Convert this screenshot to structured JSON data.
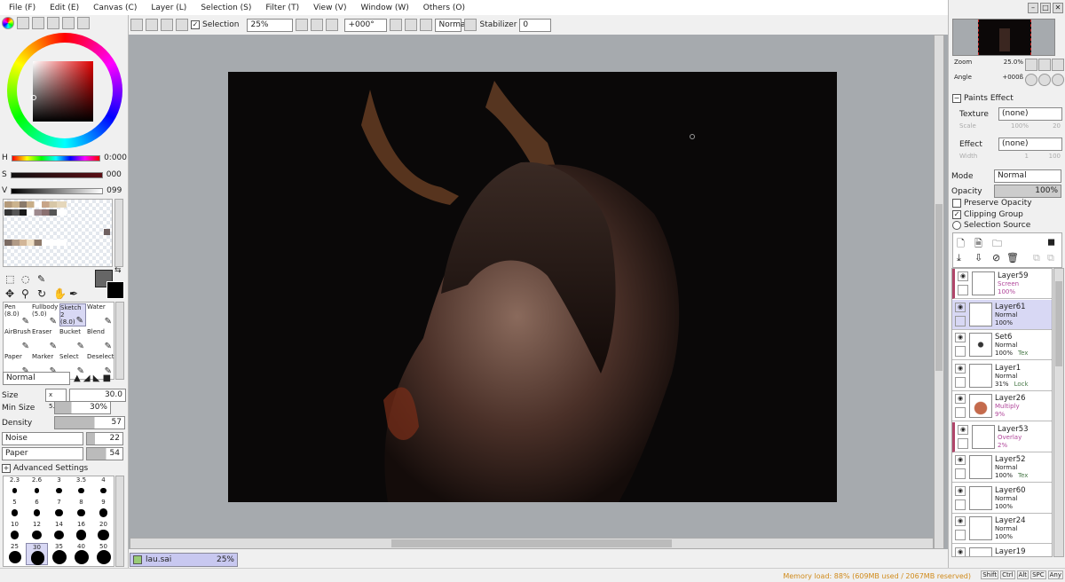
{
  "menu": [
    "File (F)",
    "Edit (E)",
    "Canvas (C)",
    "Layer (L)",
    "Selection (S)",
    "Filter (T)",
    "View (V)",
    "Window (W)",
    "Others (O)"
  ],
  "toolbar": {
    "selection_label": "Selection",
    "zoom": "25%",
    "angle": "+000°",
    "blend": "Normal",
    "stabilizer_label": "Stabilizer",
    "stabilizer_value": "0"
  },
  "color": {
    "h_label": "H",
    "h_value": "0:000",
    "s_label": "S",
    "s_value": "000",
    "v_label": "V",
    "v_value": "099",
    "accent": "#5a0e14"
  },
  "tools": {
    "brushes": [
      {
        "name": "Pen",
        "size": "(8.0)"
      },
      {
        "name": "Fullbody",
        "size": "(5.0)"
      },
      {
        "name": "Sketch 2",
        "size": "(8.0)"
      },
      {
        "name": "Water",
        "size": ""
      },
      {
        "name": "AirBrush",
        "size": ""
      },
      {
        "name": "Eraser",
        "size": ""
      },
      {
        "name": "Bucket",
        "size": ""
      },
      {
        "name": "Blend",
        "size": ""
      },
      {
        "name": "Paper",
        "size": ""
      },
      {
        "name": "Marker",
        "size": ""
      },
      {
        "name": "Select",
        "size": ""
      },
      {
        "name": "Deselect",
        "size": ""
      }
    ]
  },
  "brush": {
    "mode": "Normal",
    "size_label": "Size",
    "size_mult": "x 5.0",
    "size_value": "30.0",
    "minsize_label": "Min Size",
    "minsize_value": "30%",
    "density_label": "Density",
    "density_value": "57",
    "noise_label": "Noise",
    "noise_value": "22",
    "paper_label": "Paper",
    "paper_value": "54",
    "advanced_label": "Advanced Settings",
    "sizes": [
      "2.3",
      "2.6",
      "3",
      "3.5",
      "4",
      "5",
      "6",
      "7",
      "8",
      "9",
      "10",
      "12",
      "14",
      "16",
      "20",
      "25",
      "30",
      "35",
      "40",
      "50"
    ]
  },
  "document": {
    "name": "lau.sai",
    "zoom": "25%"
  },
  "navigator": {
    "zoom_label": "Zoom",
    "zoom_value": "25.0%",
    "angle_label": "Angle",
    "angle_value": "+000ß"
  },
  "paints": {
    "title": "Paints Effect",
    "texture_label": "Texture",
    "texture_value": "(none)",
    "scale_label": "Scale",
    "scale_value": "100%",
    "scale_num": "20",
    "effect_label": "Effect",
    "effect_value": "(none)",
    "width_label": "Width",
    "width_value": "1",
    "width_num": "100"
  },
  "layer_props": {
    "mode_label": "Mode",
    "mode_value": "Normal",
    "opacity_label": "Opacity",
    "opacity_value": "100%",
    "preserve": "Preserve Opacity",
    "clipping": "Clipping Group",
    "selsource": "Selection Source"
  },
  "layers": [
    {
      "name": "Layer59",
      "mode": "Screen",
      "opacity": "100%",
      "extra": ""
    },
    {
      "name": "Layer61",
      "mode": "Normal",
      "opacity": "100%",
      "extra": ""
    },
    {
      "name": "Set6",
      "mode": "Normal",
      "opacity": "100%",
      "extra": "Tex"
    },
    {
      "name": "Layer1",
      "mode": "Normal",
      "opacity": "31%",
      "extra": "Lock"
    },
    {
      "name": "Layer26",
      "mode": "Multiply",
      "opacity": "9%",
      "extra": ""
    },
    {
      "name": "Layer53",
      "mode": "Overlay",
      "opacity": "2%",
      "extra": ""
    },
    {
      "name": "Layer52",
      "mode": "Normal",
      "opacity": "100%",
      "extra": "Tex"
    },
    {
      "name": "Layer60",
      "mode": "Normal",
      "opacity": "100%",
      "extra": ""
    },
    {
      "name": "Layer24",
      "mode": "Normal",
      "opacity": "100%",
      "extra": ""
    },
    {
      "name": "Layer19",
      "mode": "",
      "opacity": "",
      "extra": ""
    }
  ],
  "status": {
    "memory": "Memory load: 88% (609MB used / 2067MB reserved)",
    "keys": [
      "Shift",
      "Ctrl",
      "Alt",
      "SPC",
      "Any"
    ]
  }
}
